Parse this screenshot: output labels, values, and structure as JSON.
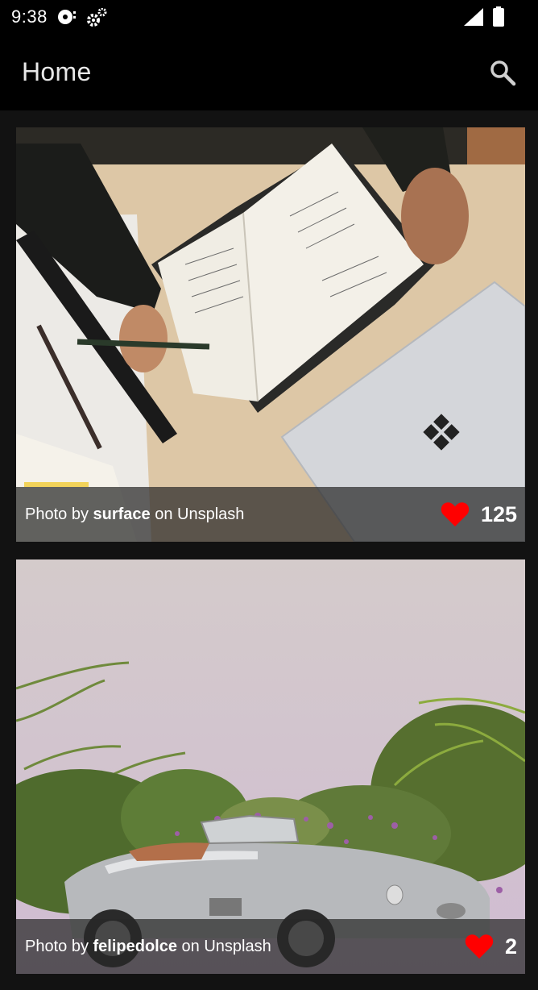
{
  "status_bar": {
    "time": "9:38",
    "icons": [
      "media-notification-icon",
      "settings-notification-icon",
      "signal-icon",
      "battery-icon"
    ]
  },
  "app_bar": {
    "title": "Home",
    "search_icon": "search-icon"
  },
  "feed": [
    {
      "caption_prefix": "Photo by ",
      "author": "surface",
      "caption_suffix": " on Unsplash",
      "likes": "125",
      "like_icon": "heart-icon",
      "photo_subject": "notebook, pencil, ruler and laptop on desk"
    },
    {
      "caption_prefix": "Photo by ",
      "author": "felipedolce",
      "caption_suffix": " on Unsplash",
      "likes": "2",
      "like_icon": "heart-icon",
      "photo_subject": "silver convertible car among ferns and flowers"
    }
  ],
  "colors": {
    "background": "#121212",
    "app_bar": "#000000",
    "heart": "#ff0000",
    "text": "#ffffff"
  }
}
